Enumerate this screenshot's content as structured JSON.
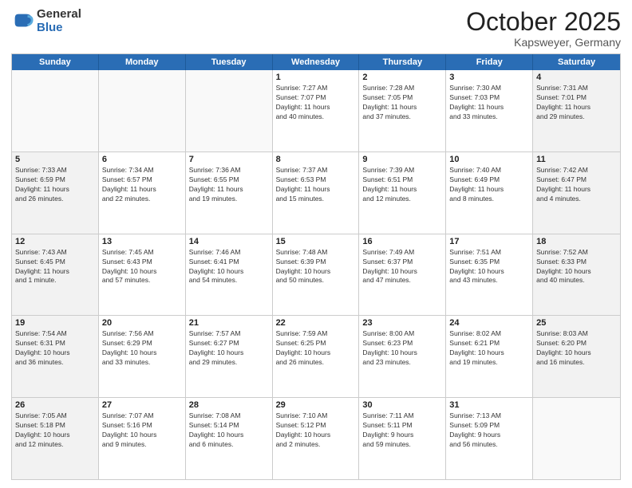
{
  "header": {
    "logo_general": "General",
    "logo_blue": "Blue",
    "month_title": "October 2025",
    "subtitle": "Kapsweyer, Germany"
  },
  "days_of_week": [
    "Sunday",
    "Monday",
    "Tuesday",
    "Wednesday",
    "Thursday",
    "Friday",
    "Saturday"
  ],
  "weeks": [
    [
      {
        "day": "",
        "text": "",
        "empty": true
      },
      {
        "day": "",
        "text": "",
        "empty": true
      },
      {
        "day": "",
        "text": "",
        "empty": true
      },
      {
        "day": "1",
        "text": "Sunrise: 7:27 AM\nSunset: 7:07 PM\nDaylight: 11 hours\nand 40 minutes.",
        "empty": false
      },
      {
        "day": "2",
        "text": "Sunrise: 7:28 AM\nSunset: 7:05 PM\nDaylight: 11 hours\nand 37 minutes.",
        "empty": false
      },
      {
        "day": "3",
        "text": "Sunrise: 7:30 AM\nSunset: 7:03 PM\nDaylight: 11 hours\nand 33 minutes.",
        "empty": false
      },
      {
        "day": "4",
        "text": "Sunrise: 7:31 AM\nSunset: 7:01 PM\nDaylight: 11 hours\nand 29 minutes.",
        "empty": false,
        "shaded": true
      }
    ],
    [
      {
        "day": "5",
        "text": "Sunrise: 7:33 AM\nSunset: 6:59 PM\nDaylight: 11 hours\nand 26 minutes.",
        "empty": false,
        "shaded": true
      },
      {
        "day": "6",
        "text": "Sunrise: 7:34 AM\nSunset: 6:57 PM\nDaylight: 11 hours\nand 22 minutes.",
        "empty": false
      },
      {
        "day": "7",
        "text": "Sunrise: 7:36 AM\nSunset: 6:55 PM\nDaylight: 11 hours\nand 19 minutes.",
        "empty": false
      },
      {
        "day": "8",
        "text": "Sunrise: 7:37 AM\nSunset: 6:53 PM\nDaylight: 11 hours\nand 15 minutes.",
        "empty": false
      },
      {
        "day": "9",
        "text": "Sunrise: 7:39 AM\nSunset: 6:51 PM\nDaylight: 11 hours\nand 12 minutes.",
        "empty": false
      },
      {
        "day": "10",
        "text": "Sunrise: 7:40 AM\nSunset: 6:49 PM\nDaylight: 11 hours\nand 8 minutes.",
        "empty": false
      },
      {
        "day": "11",
        "text": "Sunrise: 7:42 AM\nSunset: 6:47 PM\nDaylight: 11 hours\nand 4 minutes.",
        "empty": false,
        "shaded": true
      }
    ],
    [
      {
        "day": "12",
        "text": "Sunrise: 7:43 AM\nSunset: 6:45 PM\nDaylight: 11 hours\nand 1 minute.",
        "empty": false,
        "shaded": true
      },
      {
        "day": "13",
        "text": "Sunrise: 7:45 AM\nSunset: 6:43 PM\nDaylight: 10 hours\nand 57 minutes.",
        "empty": false
      },
      {
        "day": "14",
        "text": "Sunrise: 7:46 AM\nSunset: 6:41 PM\nDaylight: 10 hours\nand 54 minutes.",
        "empty": false
      },
      {
        "day": "15",
        "text": "Sunrise: 7:48 AM\nSunset: 6:39 PM\nDaylight: 10 hours\nand 50 minutes.",
        "empty": false
      },
      {
        "day": "16",
        "text": "Sunrise: 7:49 AM\nSunset: 6:37 PM\nDaylight: 10 hours\nand 47 minutes.",
        "empty": false
      },
      {
        "day": "17",
        "text": "Sunrise: 7:51 AM\nSunset: 6:35 PM\nDaylight: 10 hours\nand 43 minutes.",
        "empty": false
      },
      {
        "day": "18",
        "text": "Sunrise: 7:52 AM\nSunset: 6:33 PM\nDaylight: 10 hours\nand 40 minutes.",
        "empty": false,
        "shaded": true
      }
    ],
    [
      {
        "day": "19",
        "text": "Sunrise: 7:54 AM\nSunset: 6:31 PM\nDaylight: 10 hours\nand 36 minutes.",
        "empty": false,
        "shaded": true
      },
      {
        "day": "20",
        "text": "Sunrise: 7:56 AM\nSunset: 6:29 PM\nDaylight: 10 hours\nand 33 minutes.",
        "empty": false
      },
      {
        "day": "21",
        "text": "Sunrise: 7:57 AM\nSunset: 6:27 PM\nDaylight: 10 hours\nand 29 minutes.",
        "empty": false
      },
      {
        "day": "22",
        "text": "Sunrise: 7:59 AM\nSunset: 6:25 PM\nDaylight: 10 hours\nand 26 minutes.",
        "empty": false
      },
      {
        "day": "23",
        "text": "Sunrise: 8:00 AM\nSunset: 6:23 PM\nDaylight: 10 hours\nand 23 minutes.",
        "empty": false
      },
      {
        "day": "24",
        "text": "Sunrise: 8:02 AM\nSunset: 6:21 PM\nDaylight: 10 hours\nand 19 minutes.",
        "empty": false
      },
      {
        "day": "25",
        "text": "Sunrise: 8:03 AM\nSunset: 6:20 PM\nDaylight: 10 hours\nand 16 minutes.",
        "empty": false,
        "shaded": true
      }
    ],
    [
      {
        "day": "26",
        "text": "Sunrise: 7:05 AM\nSunset: 5:18 PM\nDaylight: 10 hours\nand 12 minutes.",
        "empty": false,
        "shaded": true
      },
      {
        "day": "27",
        "text": "Sunrise: 7:07 AM\nSunset: 5:16 PM\nDaylight: 10 hours\nand 9 minutes.",
        "empty": false
      },
      {
        "day": "28",
        "text": "Sunrise: 7:08 AM\nSunset: 5:14 PM\nDaylight: 10 hours\nand 6 minutes.",
        "empty": false
      },
      {
        "day": "29",
        "text": "Sunrise: 7:10 AM\nSunset: 5:12 PM\nDaylight: 10 hours\nand 2 minutes.",
        "empty": false
      },
      {
        "day": "30",
        "text": "Sunrise: 7:11 AM\nSunset: 5:11 PM\nDaylight: 9 hours\nand 59 minutes.",
        "empty": false
      },
      {
        "day": "31",
        "text": "Sunrise: 7:13 AM\nSunset: 5:09 PM\nDaylight: 9 hours\nand 56 minutes.",
        "empty": false
      },
      {
        "day": "",
        "text": "",
        "empty": true,
        "shaded": true
      }
    ]
  ]
}
